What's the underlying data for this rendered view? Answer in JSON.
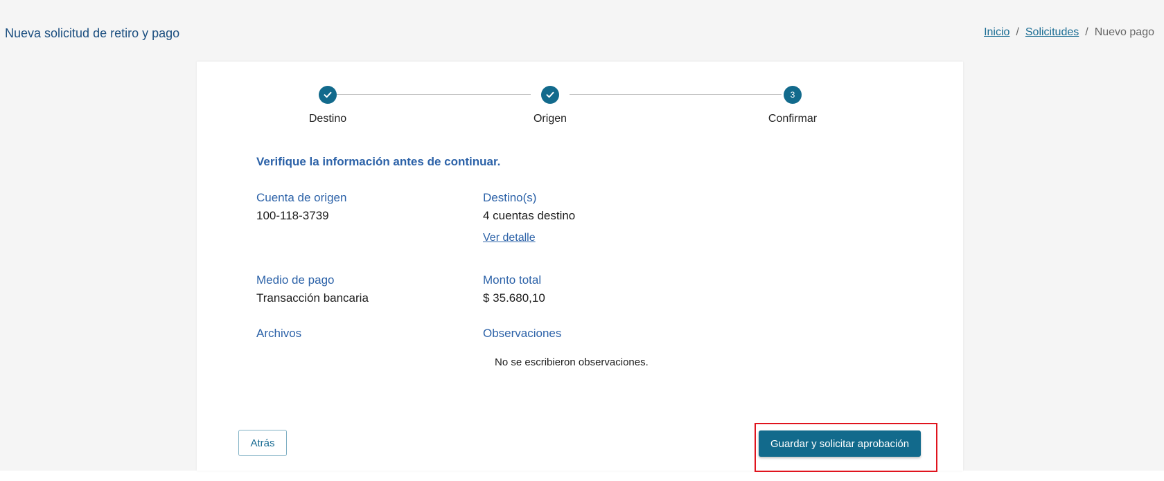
{
  "header": {
    "title": "Nueva solicitud de retiro y pago",
    "breadcrumb": {
      "home": "Inicio",
      "separator": "/",
      "requests": "Solicitudes",
      "current": "Nuevo pago"
    }
  },
  "stepper": {
    "steps": [
      {
        "label": "Destino",
        "status": "completed",
        "icon": "check-icon"
      },
      {
        "label": "Origen",
        "status": "completed",
        "icon": "check-icon"
      },
      {
        "label": "Confirmar",
        "status": "active",
        "number": "3"
      }
    ]
  },
  "summary": {
    "heading": "Verifique la información antes de continuar.",
    "origin_account_label": "Cuenta de origen",
    "origin_account_value": "100-118-3739",
    "destinations_label": "Destino(s)",
    "destinations_value": "4 cuentas destino",
    "view_detail_link": "Ver detalle",
    "payment_method_label": "Medio de pago",
    "payment_method_value": "Transacción bancaria",
    "total_amount_label": "Monto total",
    "total_amount_value": "$ 35.680,10",
    "files_label": "Archivos",
    "observations_label": "Observaciones",
    "observations_value": "No se escribieron observaciones."
  },
  "actions": {
    "back_label": "Atrás",
    "submit_label": "Guardar y solicitar aprobación"
  },
  "colors": {
    "accent": "#126a8c",
    "label_blue": "#2c62a8",
    "highlight": "#e0141e"
  }
}
